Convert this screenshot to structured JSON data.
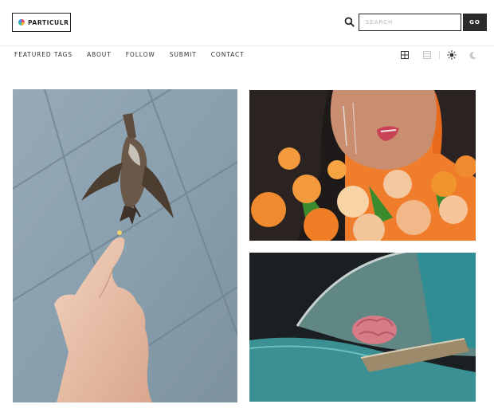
{
  "header": {
    "logo_text": "PARTICULR",
    "search_placeholder": "SEARCH",
    "go_label": "GO"
  },
  "nav": {
    "items": [
      "FEATURED TAGS",
      "ABOUT",
      "FOLLOW",
      "SUBMIT",
      "CONTACT"
    ]
  },
  "view_controls": [
    "grid-view-icon",
    "list-view-icon",
    "sun-icon",
    "moon-icon"
  ],
  "posts": [
    "photo-bird-feeding",
    "photo-flowers-portrait",
    "photo-car-brain"
  ],
  "colors": {
    "accent": "#2b2b2b",
    "border": "#222222",
    "divider": "#ececec"
  }
}
